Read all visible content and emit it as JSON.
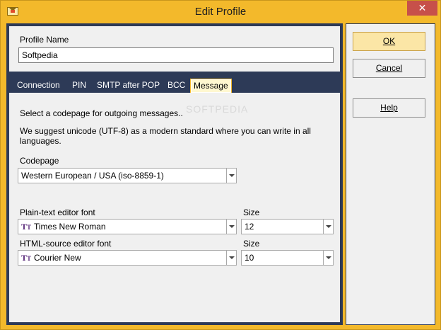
{
  "window": {
    "title": "Edit Profile",
    "close_glyph": "✕",
    "app_icon": "envelope-icon"
  },
  "profile": {
    "label": "Profile Name",
    "value": "Softpedia"
  },
  "tabs": [
    {
      "label": "Connection"
    },
    {
      "label": "PIN"
    },
    {
      "label": "SMTP after POP"
    },
    {
      "label": "BCC"
    },
    {
      "label": "Message",
      "active": true
    }
  ],
  "message": {
    "intro": "Select a codepage for outgoing messages..",
    "suggest_line1": "We suggest unicode (UTF-8) as a modern standard where you can write in all",
    "suggest_line2": "languages.",
    "codepage_label": "Codepage",
    "codepage_value": "Western European / USA (iso-8859-1)",
    "plain_font_label": "Plain-text editor font",
    "plain_font_value": "Times New Roman",
    "plain_size_label": "Size",
    "plain_size_value": "12",
    "html_font_label": "HTML-source editor font",
    "html_font_value": "Courier New",
    "html_size_label": "Size",
    "html_size_value": "10",
    "font_icon": "font-type-icon"
  },
  "buttons": {
    "ok": "OK",
    "cancel": "Cancel",
    "help": "Help"
  },
  "watermark": "SOFTPEDIA",
  "colors": {
    "accent": "#f3b92b",
    "panel_dark": "#2d3a57",
    "ok_button": "#fbe6a6"
  }
}
